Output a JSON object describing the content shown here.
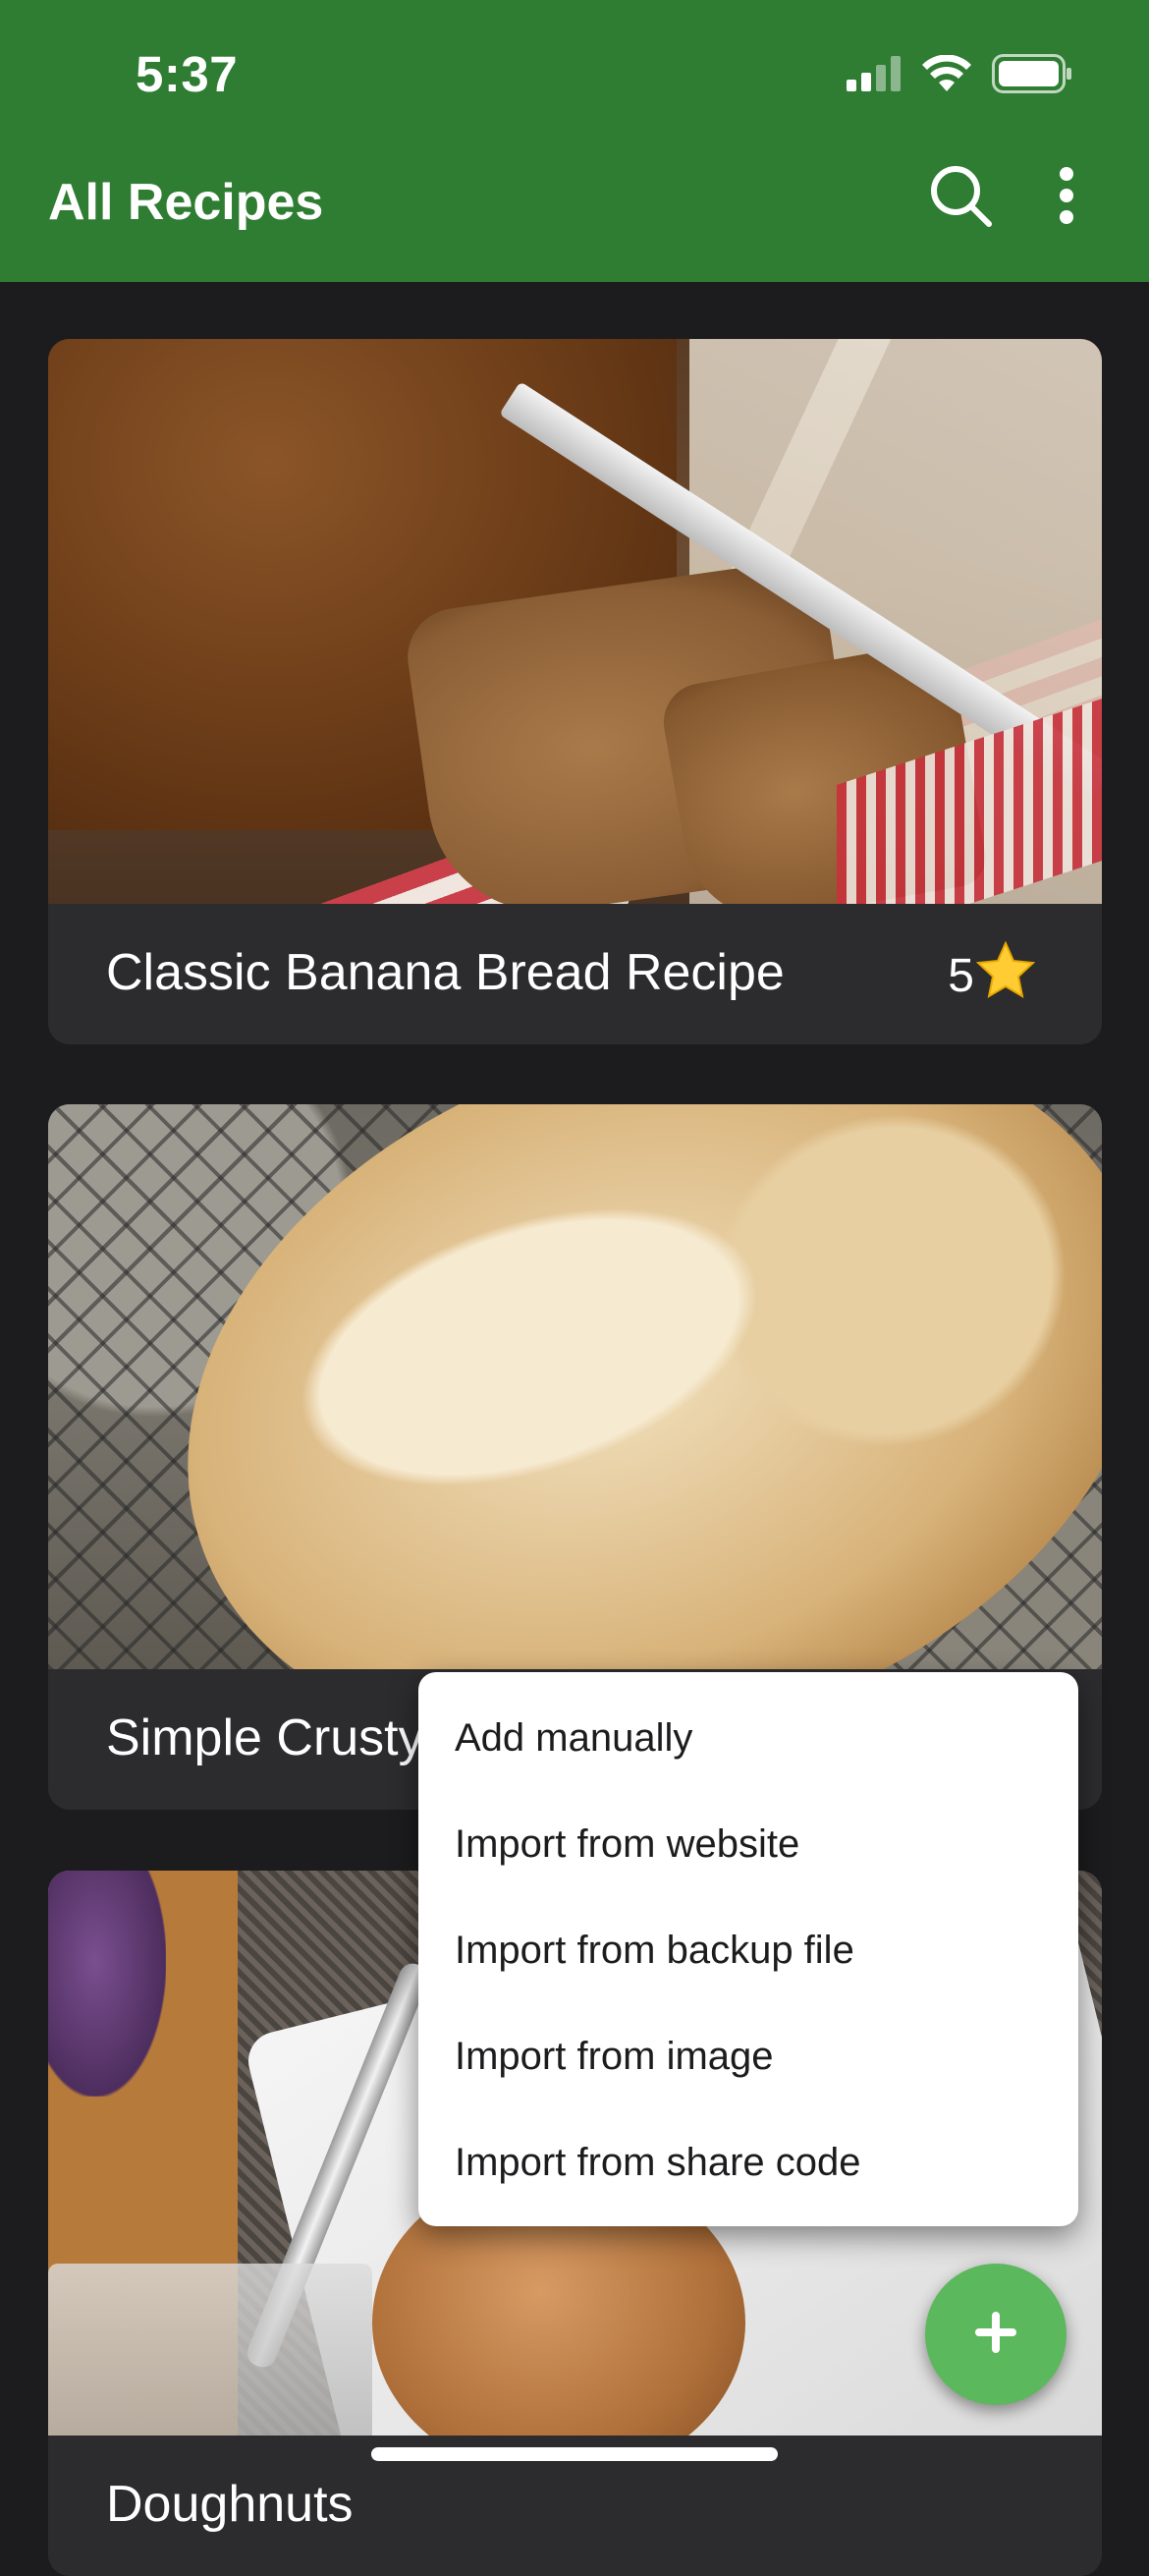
{
  "status_bar": {
    "time": "5:37"
  },
  "app_bar": {
    "title": "All Recipes",
    "color": "#2e7d32"
  },
  "recipes": [
    {
      "title": "Classic Banana Bread Recipe",
      "rating": "5",
      "rating_icon": "star-icon"
    },
    {
      "title": "Simple Crusty",
      "rating": "",
      "rating_icon": ""
    },
    {
      "title": "Doughnuts",
      "rating": "",
      "rating_icon": "star-icon"
    }
  ],
  "add_menu": {
    "items": [
      {
        "label": "Add manually"
      },
      {
        "label": "Import from website"
      },
      {
        "label": "Import from backup file"
      },
      {
        "label": "Import from image"
      },
      {
        "label": "Import from share code"
      }
    ]
  },
  "fab": {
    "icon": "plus-icon",
    "color": "#5cb85c"
  }
}
